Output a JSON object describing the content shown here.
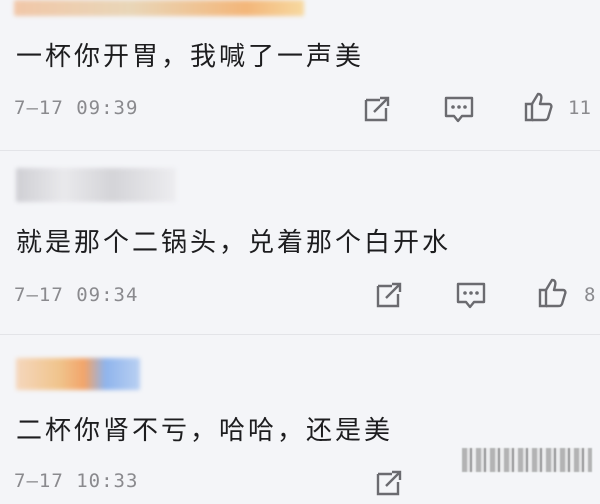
{
  "comments": [
    {
      "text": "一杯你开胃，我喊了一声美",
      "timestamp": "7—17 09:39",
      "likes": "11",
      "icons": [
        "share-icon",
        "comment-icon",
        "thumbs-up-icon"
      ]
    },
    {
      "text": "就是那个二锅头，兑着那个白开水",
      "timestamp": "7—17 09:34",
      "likes": "8",
      "icons": [
        "share-icon",
        "comment-icon",
        "thumbs-up-icon"
      ]
    },
    {
      "text": "二杯你肾不亏，哈哈，还是美",
      "timestamp": "7—17 10:33",
      "likes": "",
      "icons": [
        "share-icon",
        "comment-icon",
        "thumbs-up-icon"
      ]
    }
  ]
}
